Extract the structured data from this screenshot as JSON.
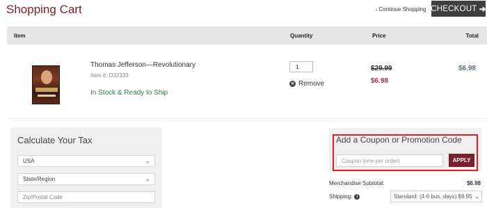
{
  "header": {
    "title": "Shopping Cart",
    "continue_label": "Continue Shopping",
    "continue_arrow": "‹",
    "checkout_label": "CHECKOUT",
    "checkout_icon": "arrow-right-icon"
  },
  "table": {
    "columns": [
      "Item",
      "Quantity",
      "Price",
      "Total"
    ]
  },
  "line_item": {
    "name": "Thomas Jefferson—Revolutionary",
    "item_number": "Item #: D32333",
    "stock_status": "In Stock & Ready to Ship",
    "quantity": "1",
    "remove_label": "Remove",
    "original_price": "$29.99",
    "sale_price": "$6.98",
    "total": "$6.98"
  },
  "tax": {
    "title": "Calculate Your Tax",
    "country": "USA",
    "state_placeholder": "State/Region",
    "zip_placeholder": "Zip/Postal Code"
  },
  "coupon": {
    "title": "Add a Coupon or Promotion Code",
    "placeholder": "Coupon (one per order)",
    "apply_label": "APPLY"
  },
  "summary": {
    "subtotal_label": "Merchandise Subtotal:",
    "subtotal_value": "$6.98",
    "shipping_label": "Shipping:",
    "shipping_option": "Standard: (4-6 bus. days) $9.95"
  },
  "colors": {
    "brand": "#7a1f2b",
    "highlight": "#e11d1d",
    "stock": "#2e7d45",
    "sale": "#a5343b"
  }
}
